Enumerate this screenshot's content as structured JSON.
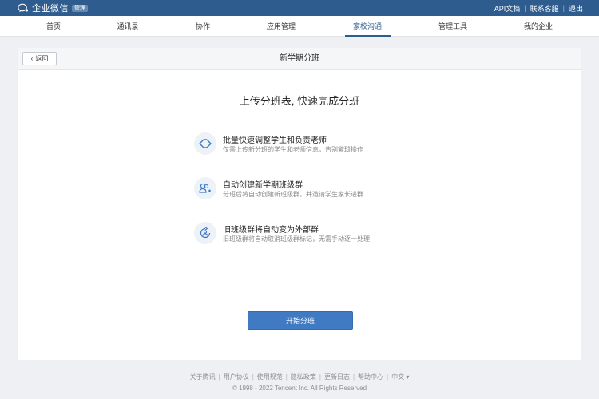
{
  "brand": {
    "name": "企业微信",
    "badge": "管理"
  },
  "top_links": [
    "API文档",
    "联系客服",
    "退出"
  ],
  "nav": {
    "items": [
      "首页",
      "通讯录",
      "协作",
      "应用管理",
      "家校沟通",
      "管理工具",
      "我的企业"
    ],
    "active": "家校沟通"
  },
  "card": {
    "back_label": "返回",
    "title": "新学期分班"
  },
  "headline": "上传分班表, 快速完成分班",
  "features": [
    {
      "icon": "swap-icon",
      "title": "批量快速调整学生和负责老师",
      "desc": "仅需上传新分班的学生和老师信息，告别繁琐操作"
    },
    {
      "icon": "group-add-icon",
      "title": "自动创建新学期班级群",
      "desc": "分班后将自动创建新班级群，并邀请学生家长进群"
    },
    {
      "icon": "external-group-icon",
      "title": "旧班级群将自动变为外部群",
      "desc": "旧班级群将自动取消班级群标记，无需手动逐一处理"
    }
  ],
  "start_button": "开始分班",
  "footer": {
    "links": [
      "关于腾讯",
      "用户协议",
      "使用规范",
      "隐私政策",
      "更新日志",
      "帮助中心",
      "中文 ▾"
    ],
    "copyright": "© 1998 - 2022 Tencent Inc. All Rights Reserved"
  },
  "colors": {
    "topbar": "#2e5c8e",
    "accent": "#3f7ac3",
    "background": "#eef0f3"
  }
}
